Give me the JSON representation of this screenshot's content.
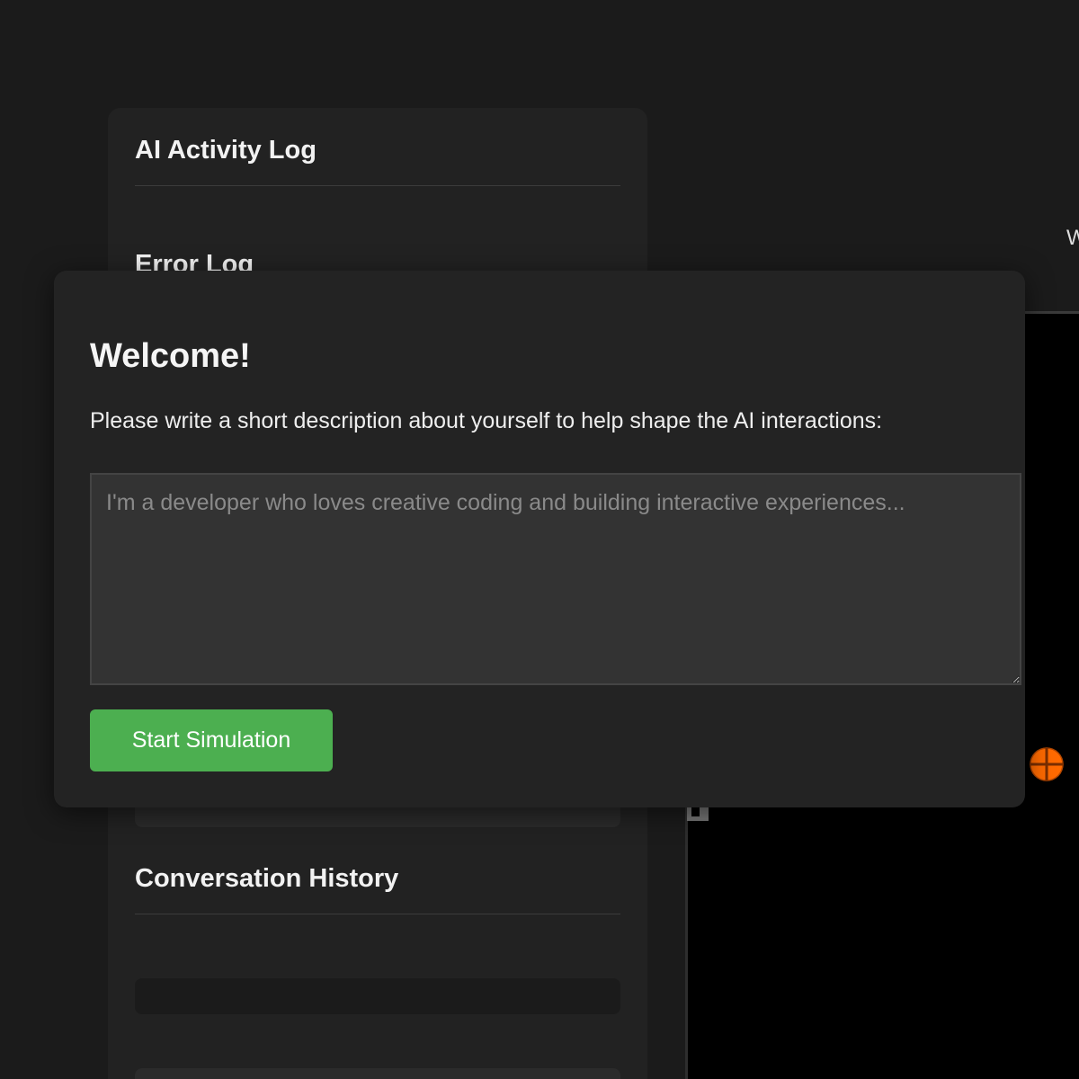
{
  "sidebar": {
    "activity_log_title": "AI Activity Log",
    "error_log_title": "Error Log",
    "conversation_history_title": "Conversation History"
  },
  "right_panel": {
    "header_partial_text": "W"
  },
  "modal": {
    "title": "Welcome!",
    "prompt": "Please write a short description about yourself to help shape the AI interactions:",
    "description_placeholder": "I'm a developer who loves creative coding and building interactive experiences...",
    "description_value": "",
    "start_button_label": "Start Simulation"
  },
  "colors": {
    "page_background": "#1b1b1b",
    "panel_background": "#222222",
    "modal_background": "#232323",
    "textarea_background": "#333333",
    "accent_green": "#4caf50",
    "canvas_background": "#000000",
    "agent_marker_orange": "#ff6a00"
  },
  "icons": {
    "agent_marker": "crosshair-circle-icon"
  }
}
